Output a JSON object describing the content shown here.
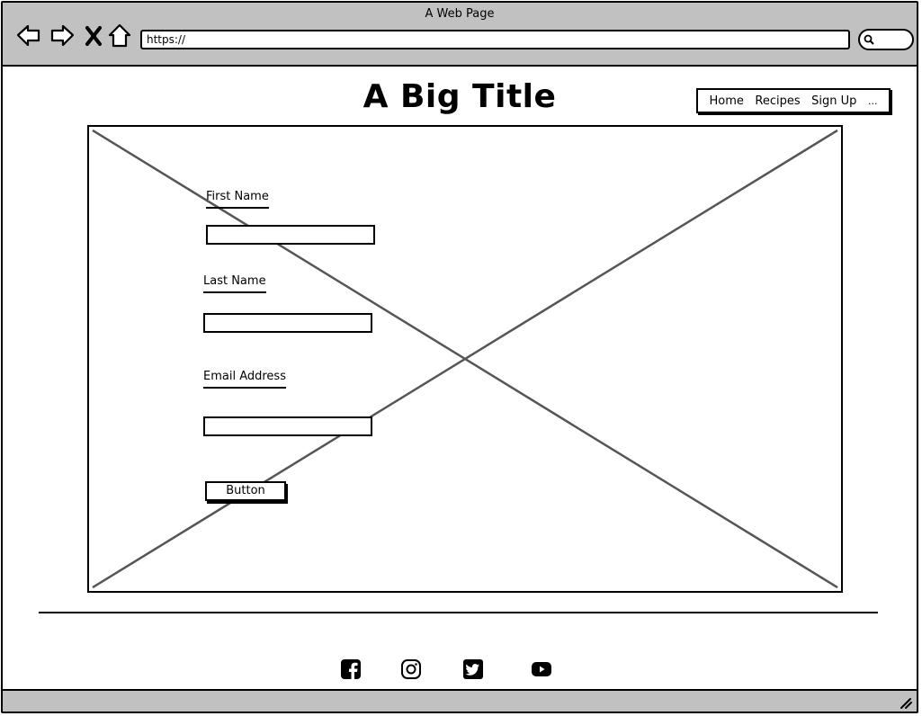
{
  "window": {
    "title": "A Web Page"
  },
  "toolbar": {
    "back_icon": "back-arrow-icon",
    "forward_icon": "forward-arrow-icon",
    "stop_icon": "close-icon",
    "home_icon": "home-icon",
    "url": "https://",
    "search_icon": "search-icon"
  },
  "header": {
    "title": "A Big Title",
    "nav": {
      "items": [
        "Home",
        "Recipes",
        "Sign Up"
      ],
      "more": "..."
    }
  },
  "hero": {
    "placeholder_icon": "image-placeholder"
  },
  "form": {
    "first_name_label": "First Name",
    "last_name_label": "Last Name",
    "email_label": "Email Address",
    "first_name_value": "",
    "last_name_value": "",
    "email_value": "",
    "submit_label": "Button"
  },
  "footer": {
    "social": [
      "facebook-icon",
      "instagram-icon",
      "twitter-icon",
      "youtube-icon"
    ]
  },
  "colors": {
    "chrome": "#c1c1c1",
    "placeholder_cross": "#555555",
    "stroke": "#000000"
  }
}
